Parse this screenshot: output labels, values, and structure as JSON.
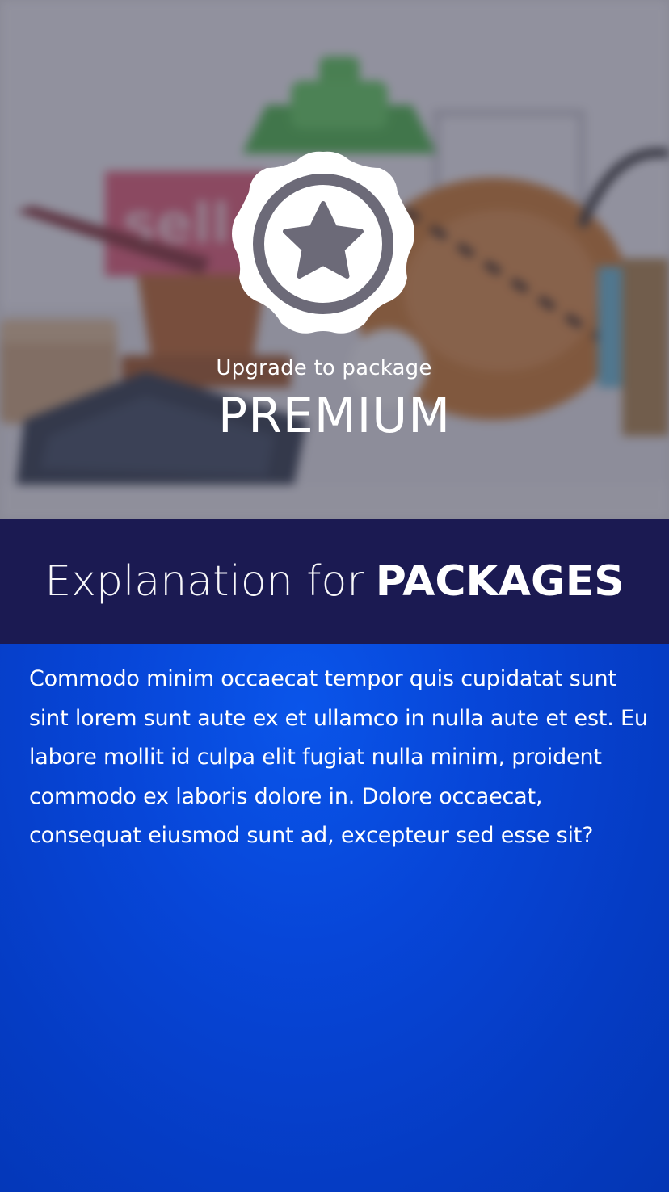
{
  "hero": {
    "badge_icon": "star-seal-icon",
    "subtitle": "Upgrade to package",
    "title": "PREMIUM"
  },
  "explanation": {
    "heading_light": "Explanation for",
    "heading_bold": "PACKAGES"
  },
  "body": {
    "text": "Commodo minim occaecat tempor quis cupidatat sunt sint lorem sunt aute ex et ullamco in nulla aute et est. Eu labore mollit id culpa elit fugiat nulla minim, proident commodo ex laboris dolore in. Dolore occaecat, consequat eiusmod sunt ad, excepteur sed esse sit?"
  },
  "colors": {
    "band_background": "#1b1a52",
    "body_background": "#0746d8",
    "text": "#ffffff"
  }
}
